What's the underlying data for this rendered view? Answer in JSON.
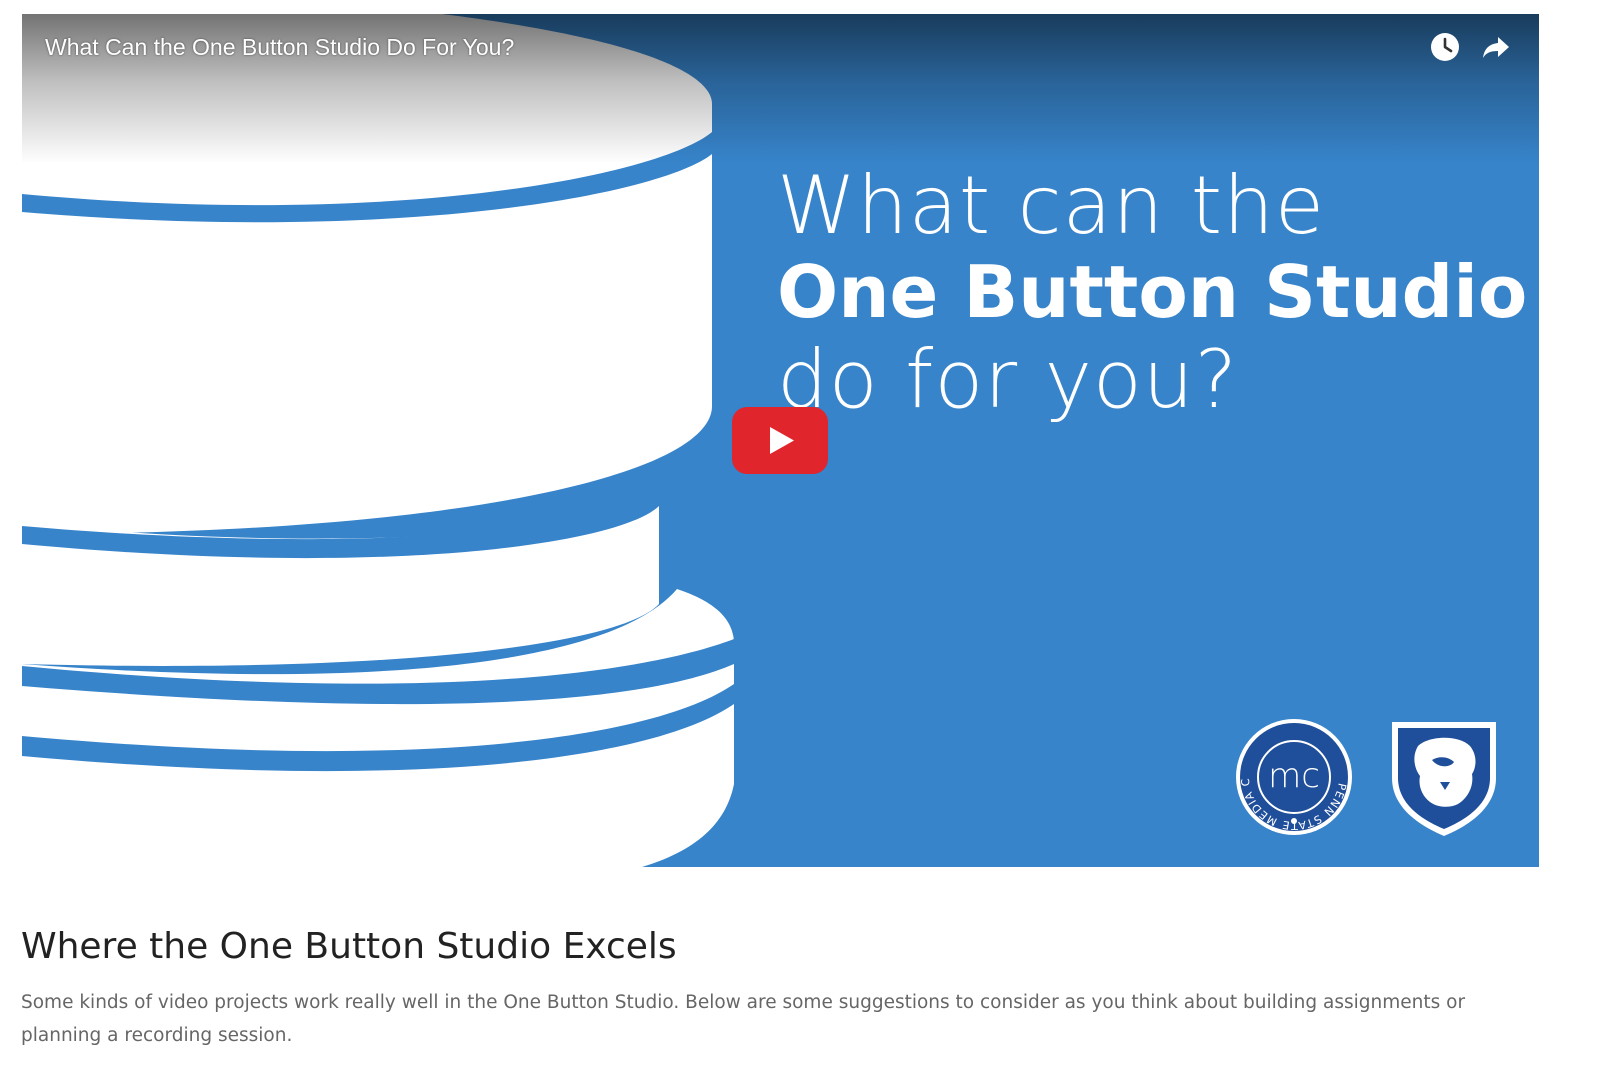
{
  "video": {
    "title": "What Can the One Button Studio Do For You?",
    "headline_line1": "What can the",
    "headline_line2": "One Button Studio",
    "headline_line3": "do for you?",
    "background_color": "#3784cb",
    "play_button_color": "#e0252c",
    "icons": {
      "watch_later": "clock-icon",
      "share": "share-arrow-icon",
      "play": "play-icon"
    },
    "logos": {
      "media_commons_text": "PENN STATE MEDIA COMMONS",
      "media_commons_mark": "mc",
      "university_logo": "nittany-lion-shield"
    }
  },
  "section": {
    "heading": "Where the One Button Studio Excels",
    "body": "Some kinds of video projects work really well in the One Button Studio. Below are some suggestions to consider as you think about building assignments or planning a recording session."
  }
}
